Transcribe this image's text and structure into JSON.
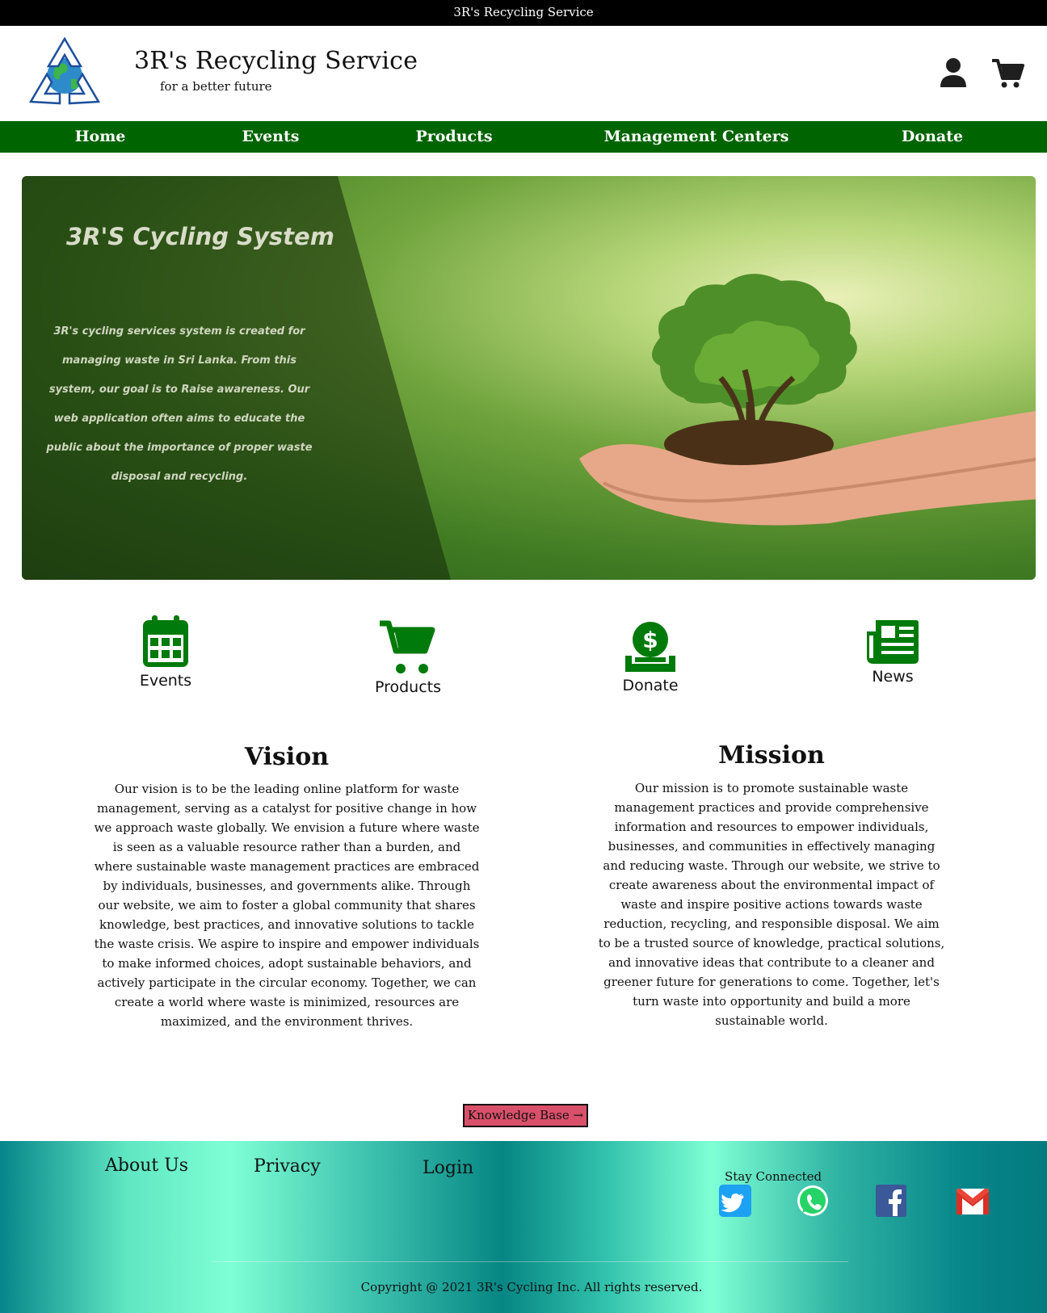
{
  "topbar": {
    "title": "3R's Recycling Service"
  },
  "header": {
    "brand_title": "3R's Recycling Service",
    "tagline": "for a better future",
    "icons": [
      "user-icon",
      "cart-icon"
    ]
  },
  "nav": {
    "items": [
      {
        "label": "Home"
      },
      {
        "label": "Events"
      },
      {
        "label": "Products"
      },
      {
        "label": "Management Centers"
      },
      {
        "label": "Donate"
      }
    ]
  },
  "hero": {
    "title": "3R'S Cycling System",
    "text": "3R's cycling services system is created for managing waste in Sri Lanka. From this system, our goal is to Raise awareness. Our web application often aims to educate the public about the importance of proper waste disposal and recycling."
  },
  "quick_links": [
    {
      "label": "Events",
      "icon": "calendar-icon"
    },
    {
      "label": "Products",
      "icon": "cart-icon"
    },
    {
      "label": "Donate",
      "icon": "donate-icon"
    },
    {
      "label": "News",
      "icon": "newspaper-icon"
    }
  ],
  "vision": {
    "title": "Vision",
    "text": "Our vision is to be the leading online platform for waste management, serving as a catalyst for positive change in how we approach waste globally. We envision a future where waste is seen as a valuable resource rather than a burden, and where sustainable waste management practices are embraced by individuals, businesses, and governments alike. Through our website, we aim to foster a global community that shares knowledge, best practices, and innovative solutions to tackle the waste crisis. We aspire to inspire and empower individuals to make informed choices, adopt sustainable behaviors, and actively participate in the circular economy. Together, we can create a world where waste is minimized, resources are maximized, and the environment thrives."
  },
  "mission": {
    "title": "Mission",
    "text": "Our mission is to promote sustainable waste management practices and provide comprehensive information and resources to empower individuals, businesses, and communities in effectively managing and reducing waste. Through our website, we strive to create awareness about the environmental impact of waste and inspire positive actions towards waste reduction, recycling, and responsible disposal. We aim to be a trusted source of knowledge, practical solutions, and innovative ideas that contribute to a cleaner and greener future for generations to come. Together, let's turn waste into opportunity and build a more sustainable world."
  },
  "knowledge_base": {
    "label": "Knowledge Base"
  },
  "footer": {
    "links": [
      {
        "label": "About Us"
      },
      {
        "label": "Privacy"
      },
      {
        "label": "Login"
      }
    ],
    "stay_connected": "Stay Connected",
    "social": [
      "twitter-icon",
      "whatsapp-icon",
      "facebook-icon",
      "gmail-icon"
    ],
    "copyright": "Copyright @ 2021 3R's Cycling Inc. All rights reserved."
  },
  "colors": {
    "nav_green": "#006400",
    "icon_green": "#007a0a",
    "button_red": "#d9506a",
    "footer_teal": "#068683",
    "footer_aqua": "#7fffd4"
  }
}
